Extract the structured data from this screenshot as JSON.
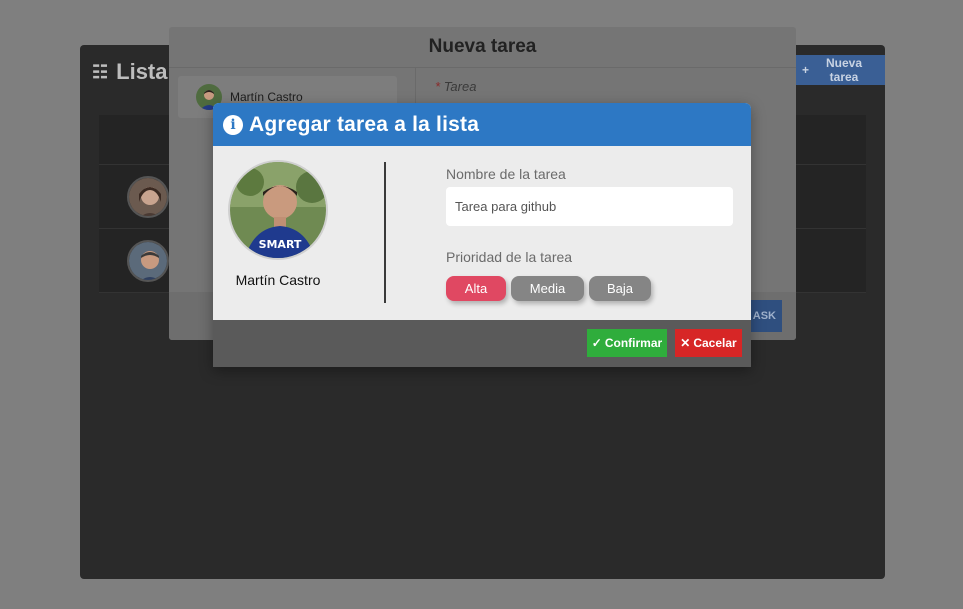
{
  "app": {
    "title": "Lista",
    "new_task_label": "Nueva tarea"
  },
  "mid_modal": {
    "title": "Nueva tarea",
    "selected_user": "Martín Castro",
    "field_label": "Tarea",
    "required_mark": "*",
    "footer_button_partial": "ASK"
  },
  "dialog": {
    "title": "Agregar tarea a la lista",
    "user_name": "Martín Castro",
    "task_name_label": "Nombre de la tarea",
    "task_name_placeholder": "Tarea para github",
    "priority_label": "Prioridad de la tarea",
    "priorities": [
      "Alta",
      "Media",
      "Baja"
    ],
    "selected_priority": "Alta",
    "confirm_label": "Confirmar",
    "cancel_label": "Cacelar"
  },
  "colors": {
    "header_blue": "#2d78c4",
    "priority_selected": "#e04862",
    "priority_default": "#858585",
    "confirm_green": "#2fad3c",
    "cancel_red": "#d72626"
  },
  "icons": {
    "app_title": "checklist-icon",
    "new_task": "plus-icon",
    "dialog_header": "info-icon",
    "confirm": "check-icon",
    "cancel": "close-icon"
  }
}
